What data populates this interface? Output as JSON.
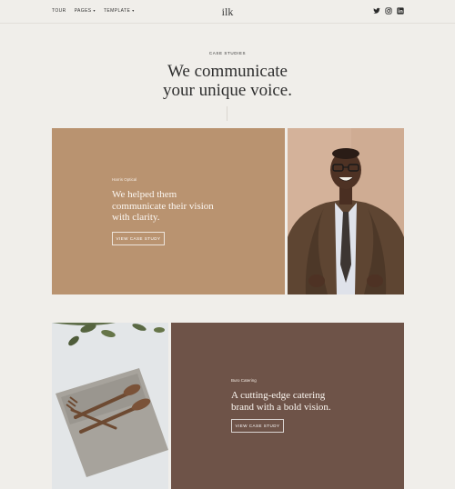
{
  "nav": {
    "items": [
      {
        "label": "TOUR",
        "dropdown": false
      },
      {
        "label": "PAGES",
        "dropdown": true
      },
      {
        "label": "TEMPLATE",
        "dropdown": true
      }
    ],
    "logo": "ilk",
    "social": [
      "twitter-icon",
      "instagram-icon",
      "linkedin-icon"
    ]
  },
  "hero": {
    "eyebrow": "CASE STUDIES",
    "headline_line1": "We communicate",
    "headline_line2": "your unique voice."
  },
  "cases": [
    {
      "client": "Harris Optical",
      "headline_line1": "We helped them",
      "headline_line2": "communicate their vision",
      "headline_line3": "with clarity.",
      "cta": "VIEW CASE STUDY",
      "color": "#b99370"
    },
    {
      "client": "Buro Catering",
      "headline_line1": "A cutting-edge catering",
      "headline_line2": "brand with a bold vision.",
      "cta": "VIEW CASE STUDY",
      "color": "#6e5348"
    }
  ]
}
